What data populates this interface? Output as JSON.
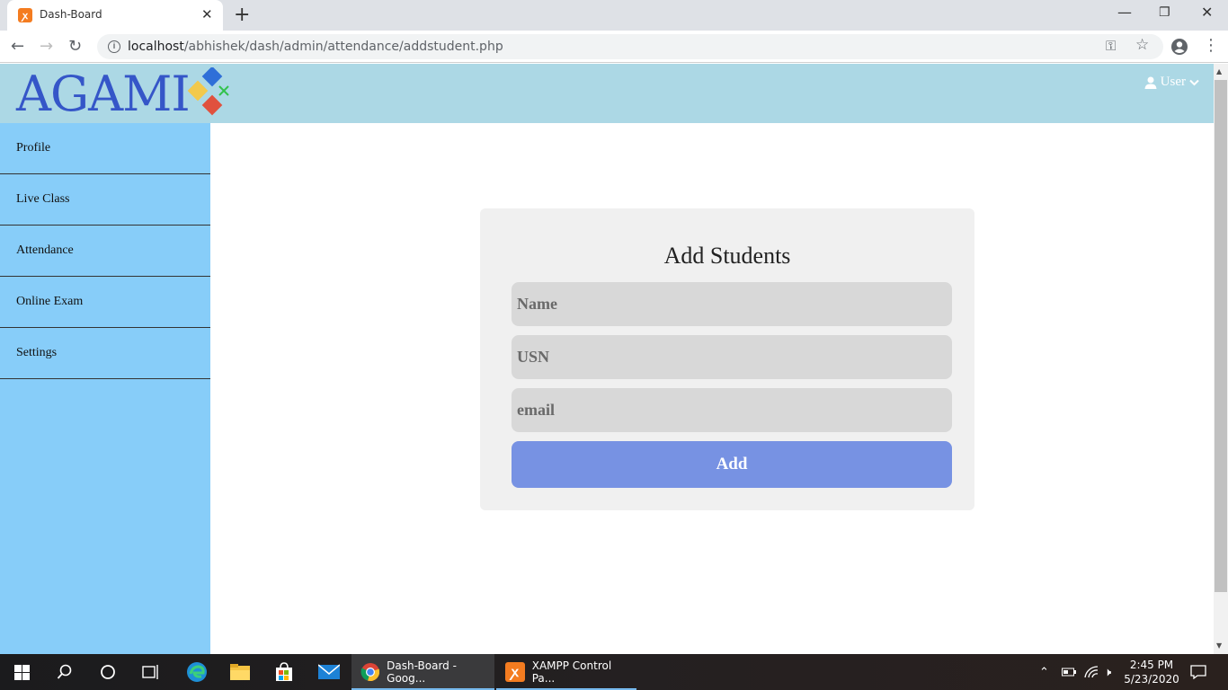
{
  "browser": {
    "tab_title": "Dash-Board",
    "tab_favicon": "xampp-icon",
    "url_host": "localhost",
    "url_path": "/abhishek/dash/admin/attendance/addstudent.php",
    "new_tab_symbol": "+",
    "close_symbol": "✕"
  },
  "header": {
    "logo_text": "AGAMI",
    "user_label": "User"
  },
  "sidebar": {
    "items": [
      {
        "label": "Profile"
      },
      {
        "label": "Live Class"
      },
      {
        "label": "Attendance"
      },
      {
        "label": "Online Exam"
      },
      {
        "label": "Settings"
      }
    ]
  },
  "form": {
    "title": "Add Students",
    "name_placeholder": "Name",
    "usn_placeholder": "USN",
    "email_placeholder": "email",
    "add_label": "Add"
  },
  "taskbar": {
    "apps": [
      {
        "label": "Dash-Board - Goog...",
        "icon": "chrome-icon"
      },
      {
        "label": "XAMPP Control Pa...",
        "icon": "xampp-icon"
      }
    ],
    "time": "2:45 PM",
    "date": "5/23/2020"
  },
  "colors": {
    "header_bg": "#acd8e5",
    "sidebar_bg": "#87cdf9",
    "card_bg": "#f0f0f0",
    "field_bg": "#d8d8d8",
    "button_bg": "#7792e3"
  }
}
